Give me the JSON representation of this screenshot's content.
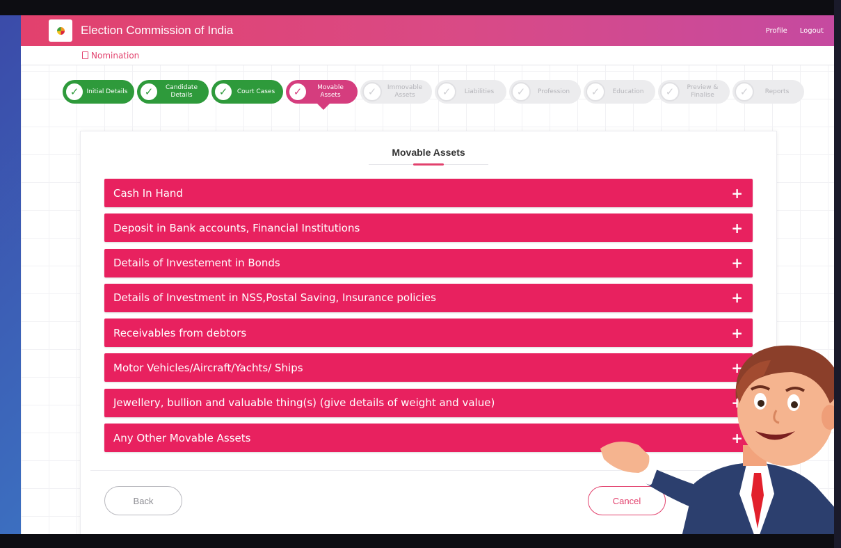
{
  "header": {
    "app_title": "Election Commission of India",
    "links": [
      "Profile",
      "Logout"
    ]
  },
  "breadcrumb": {
    "label": "Nomination"
  },
  "stepper": {
    "steps": [
      {
        "label": "Initial Details",
        "state": "done"
      },
      {
        "label": "Candidate Details",
        "state": "done"
      },
      {
        "label": "Court Cases",
        "state": "done"
      },
      {
        "label": "Movable Assets",
        "state": "active"
      },
      {
        "label": "Immovable Assets",
        "state": "todo"
      },
      {
        "label": "Liabilities",
        "state": "todo"
      },
      {
        "label": "Profession",
        "state": "todo"
      },
      {
        "label": "Education",
        "state": "todo"
      },
      {
        "label": "Preview & Finalise",
        "state": "todo"
      },
      {
        "label": "Reports",
        "state": "todo"
      }
    ]
  },
  "main": {
    "title": "Movable Assets",
    "sections": [
      "Cash In Hand",
      "Deposit in Bank accounts, Financial Institutions",
      "Details of Investement in Bonds",
      "Details of Investment in NSS,Postal Saving, Insurance policies",
      "Receivables from debtors",
      "Motor Vehicles/Aircraft/Yachts/ Ships",
      "Jewellery, bullion and valuable thing(s) (give details of weight and value)",
      "Any Other Movable Assets"
    ],
    "expand_symbol": "+",
    "back_label": "Back",
    "cancel_label": "Cancel"
  },
  "colors": {
    "accent": "#e8215f",
    "header_start": "#e2416d",
    "header_end": "#c54aa0",
    "done": "#2e9a3b",
    "active": "#d53d7e"
  },
  "icons": {
    "logo": "eci-logo-icon",
    "breadcrumb": "document-icon",
    "step_check": "check-icon",
    "expand": "plus-icon",
    "mascot": "presenter-illustration"
  }
}
